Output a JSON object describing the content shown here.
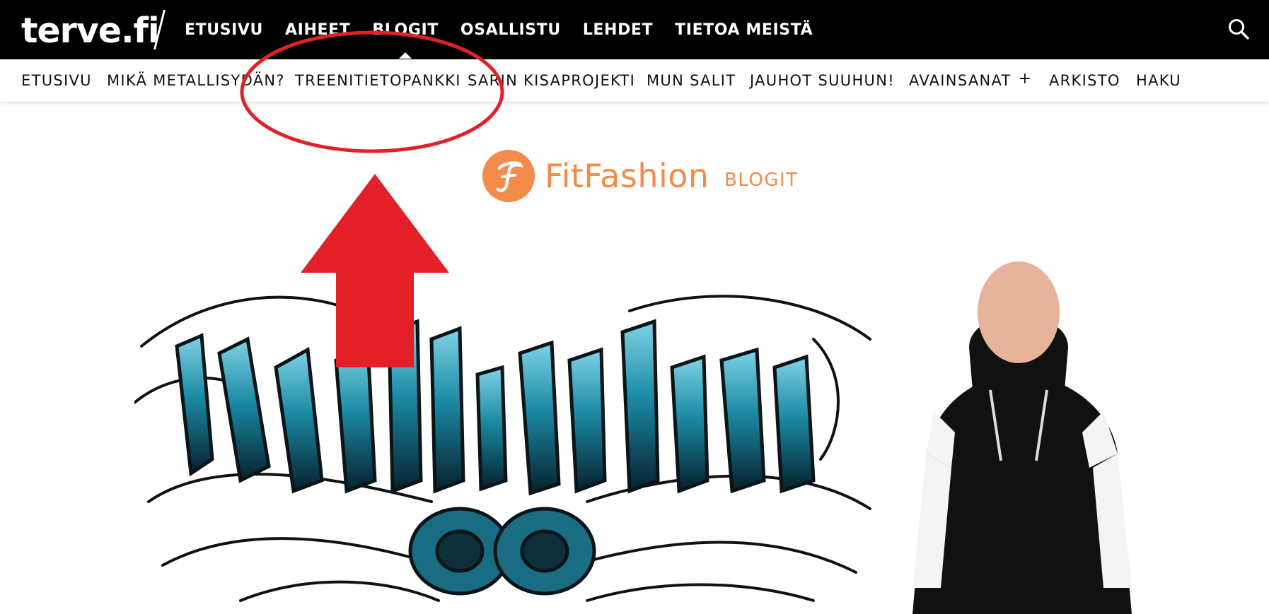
{
  "site": {
    "logo_text": "terve.fi"
  },
  "top_nav": {
    "items": [
      {
        "label": "ETUSIVU"
      },
      {
        "label": "AIHEET"
      },
      {
        "label": "BLOGIT"
      },
      {
        "label": "OSALLISTU"
      },
      {
        "label": "LEHDET"
      },
      {
        "label": "TIETOA MEISTÄ"
      }
    ],
    "active_index": 2,
    "search_icon": "search-icon"
  },
  "sub_nav": {
    "items": [
      {
        "label": "ETUSIVU"
      },
      {
        "label": "MIKÄ METALLISYDÄN?"
      },
      {
        "label": "TREENITIETOPANKKI"
      },
      {
        "label": "SARIN KISAPROJEKTI"
      },
      {
        "label": "MUN SALIT"
      },
      {
        "label": "JAUHOT SUUHUN!"
      },
      {
        "label": "AVAINSANAT",
        "expand": "+"
      },
      {
        "label": "ARKISTO"
      },
      {
        "label": "HAKU"
      }
    ]
  },
  "brand": {
    "name": "FitFashion",
    "suffix": "BLOGIT",
    "icon": "fitfashion-f-icon",
    "color": "#f38b4a"
  },
  "hero": {
    "title_art": "Metallisydän",
    "logo_colors": [
      "#1b8fa8",
      "#0d2b3a",
      "#000000"
    ]
  },
  "annotations": {
    "color": "#e32027"
  }
}
